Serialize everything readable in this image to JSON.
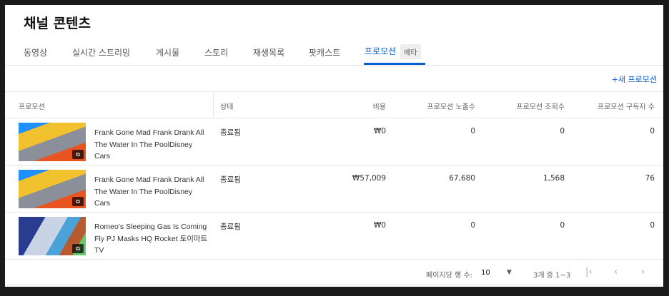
{
  "title": "채널 콘텐츠",
  "tabs": [
    "동영상",
    "실시간 스트리밍",
    "게시물",
    "스토리",
    "재생목록",
    "팟캐스트",
    "프로모션"
  ],
  "beta": "베타",
  "new_promotion": "+새 프로모션",
  "columns": [
    "프로모션",
    "상태",
    "비용",
    "프로모션 노출수",
    "프로모션 조회수",
    "프로모션 구독자 수"
  ],
  "rows": [
    {
      "title": "Frank Gone Mad Frank Drank All The Water In The PoolDisney Cars",
      "status": "종료됨",
      "cost": "₩0",
      "impressions": "0",
      "views": "0",
      "subscribers": "0"
    },
    {
      "title": "Frank Gone Mad Frank Drank All The Water In The PoolDisney Cars",
      "status": "종료됨",
      "cost": "₩57,009",
      "impressions": "67,680",
      "views": "1,568",
      "subscribers": "76"
    },
    {
      "title": "Romeo's Sleeping Gas Is Coming Fly PJ Masks HQ Rocket 토이마트TV",
      "status": "종료됨",
      "cost": "₩0",
      "impressions": "0",
      "views": "0",
      "subscribers": "0"
    }
  ],
  "pagination": {
    "rows_per_page_label": "페이지당 행 수:",
    "rows_per_page": "10",
    "range": "3개 중 1~3"
  }
}
